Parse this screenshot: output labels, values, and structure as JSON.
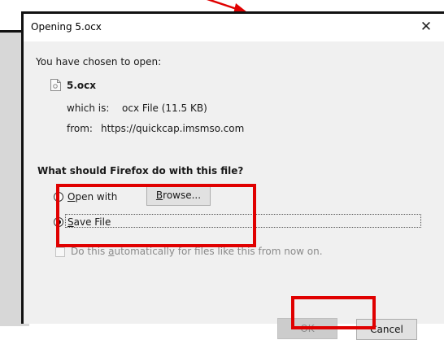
{
  "dialog": {
    "title": "Opening 5.ocx",
    "close_glyph": "✕",
    "intro": "You have chosen to open:",
    "file_icon": "document-icon",
    "filename": "5.ocx",
    "which_label": "which is:",
    "which_value": "ocx File (11.5 KB)",
    "from_label": "from:",
    "from_value": "https://quickcap.imsmso.com",
    "question": "What should Firefox do with this file?",
    "open_with": {
      "pre": "",
      "key": "O",
      "post": "pen with",
      "selected": false
    },
    "browse": {
      "pre": "",
      "key": "B",
      "post": "rowse..."
    },
    "save_file": {
      "pre": "",
      "key": "S",
      "post": "ave File",
      "selected": true
    },
    "auto": {
      "pre": "Do this ",
      "key": "a",
      "post": "utomatically for files like this from now on.",
      "checked": false,
      "enabled": false
    },
    "ok_label": "OK",
    "ok_enabled": false,
    "cancel_label": "Cancel"
  },
  "colors": {
    "highlight": "#e00000",
    "dialog_body": "#f0f0f0",
    "backdrop": "#d7d7d7"
  }
}
